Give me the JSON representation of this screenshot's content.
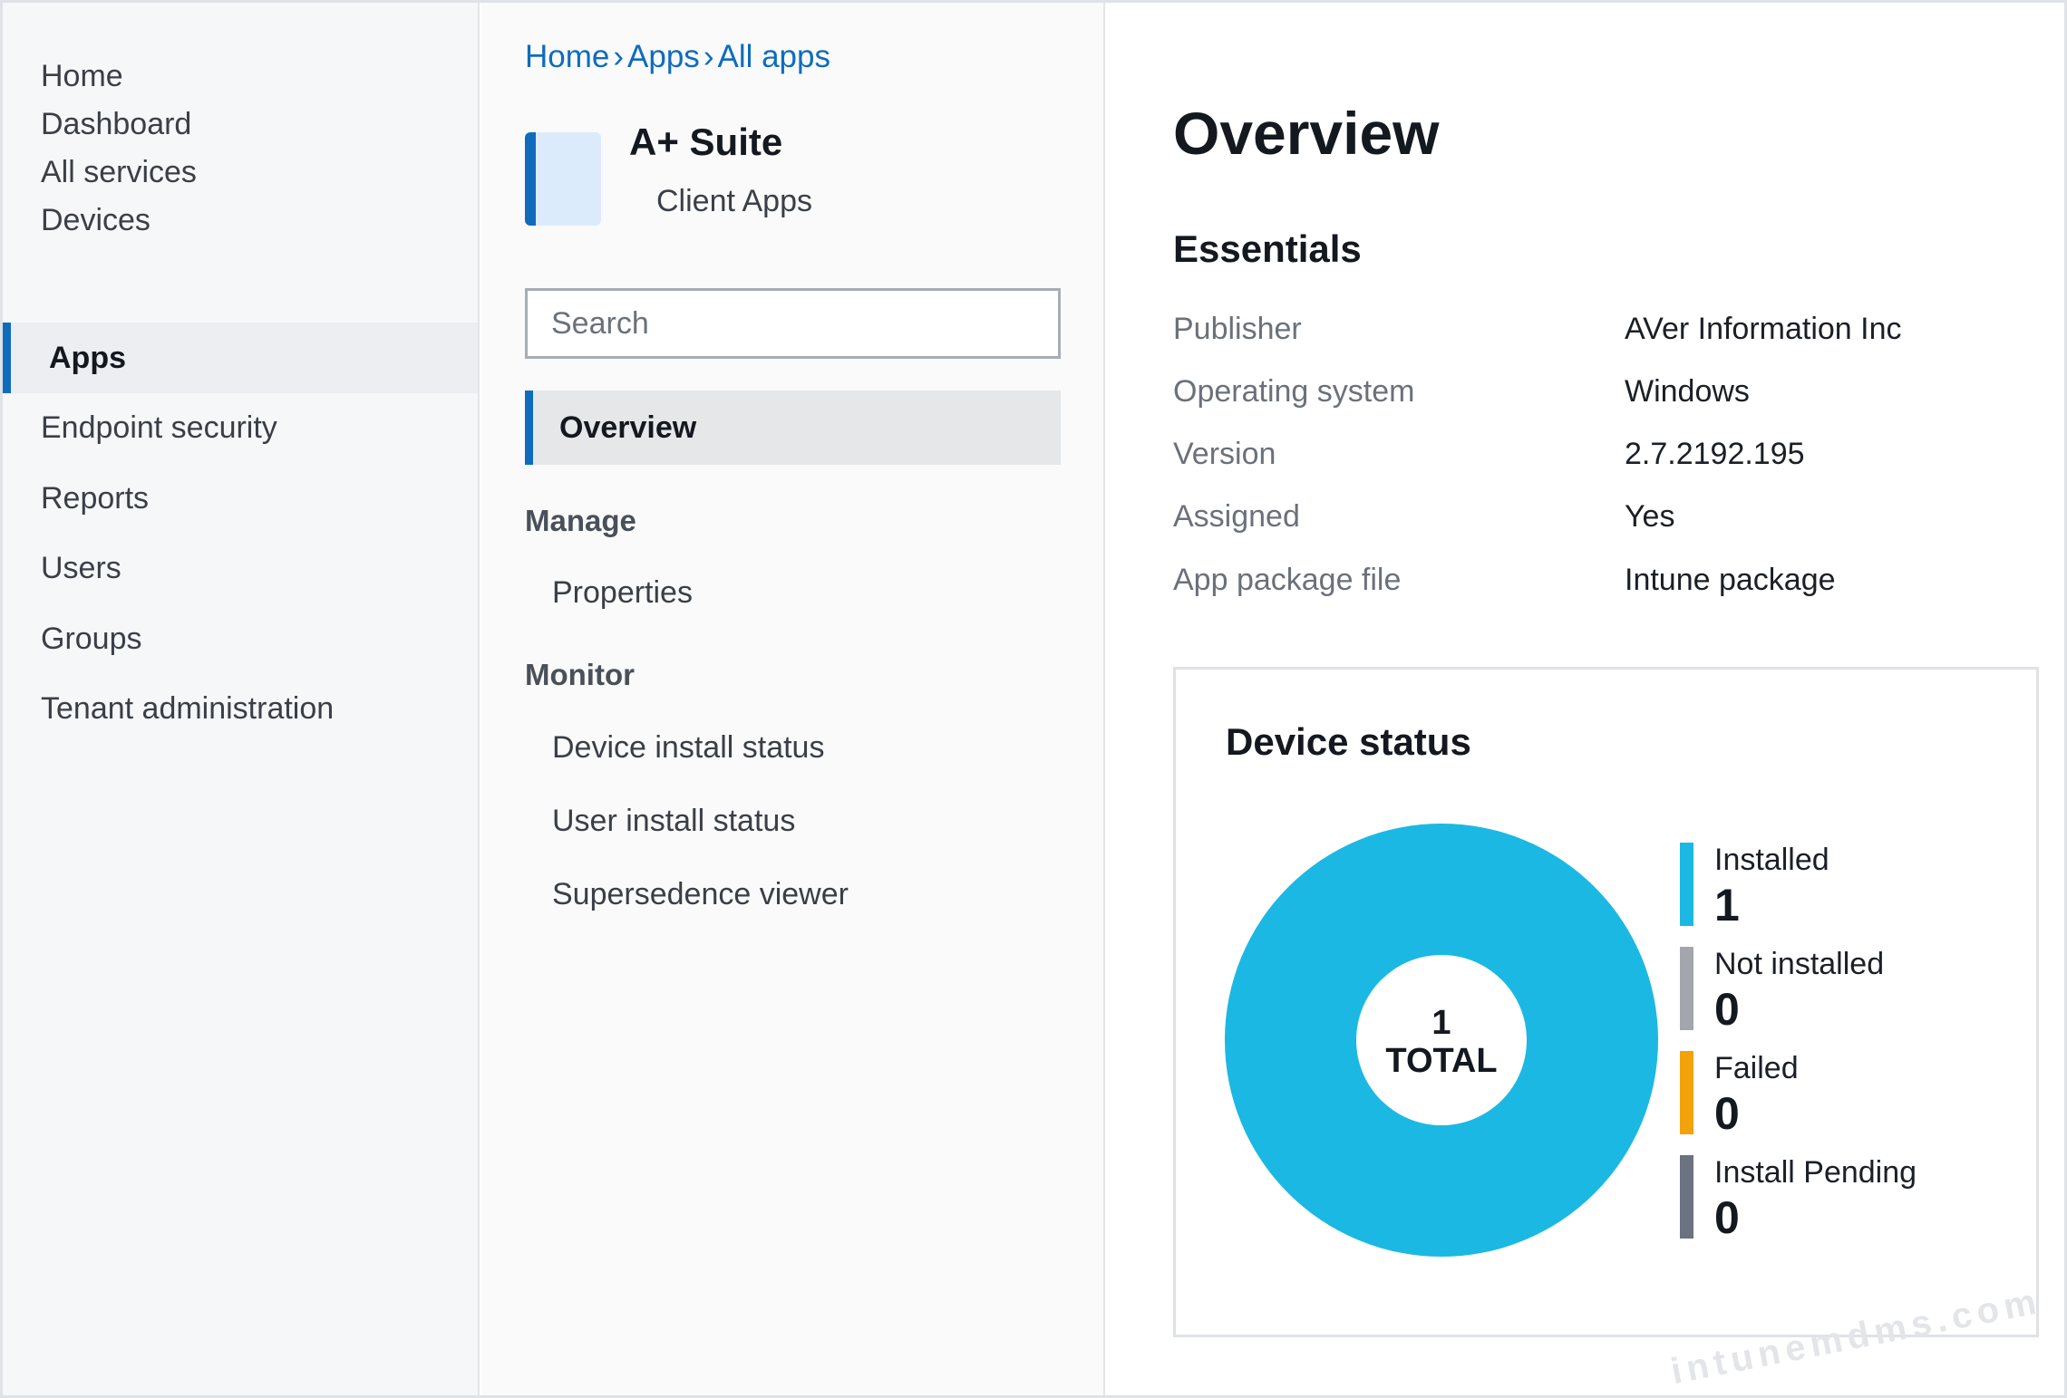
{
  "leftnav": {
    "items": [
      {
        "label": "Home"
      },
      {
        "label": "Dashboard"
      },
      {
        "label": "All services"
      },
      {
        "label": "Devices"
      },
      {
        "label": "Apps",
        "active": true
      },
      {
        "label": "Endpoint security"
      },
      {
        "label": "Reports"
      },
      {
        "label": "Users"
      },
      {
        "label": "Groups"
      },
      {
        "label": "Tenant administration"
      }
    ]
  },
  "blade": {
    "breadcrumb": [
      "Home",
      "Apps",
      "All apps"
    ],
    "breadcrumb_separator": "›",
    "app_name": "A+ Suite",
    "app_subtitle": "Client Apps",
    "search_placeholder": "Search",
    "active_item": "Overview",
    "sections": [
      {
        "heading": "Manage",
        "items": [
          "Properties"
        ]
      },
      {
        "heading": "Monitor",
        "items": [
          "Device install status",
          "User install status",
          "Supersedence viewer"
        ]
      }
    ]
  },
  "content": {
    "title": "Overview",
    "essentials_title": "Essentials",
    "essentials": [
      {
        "label": "Publisher",
        "value": "AVer Information Inc"
      },
      {
        "label": "Operating system",
        "value": "Windows"
      },
      {
        "label": "Version",
        "value": "2.7.2192.195"
      },
      {
        "label": "Assigned",
        "value": "Yes"
      },
      {
        "label": "App package file",
        "value": "Intune package"
      }
    ]
  },
  "device_status": {
    "title": "Device status",
    "total_value": "1",
    "total_label": "TOTAL",
    "legend": [
      {
        "label": "Installed",
        "count": "1",
        "color": "#1bb8e3"
      },
      {
        "label": "Not installed",
        "count": "0",
        "color": "#a3a6ad"
      },
      {
        "label": "Failed",
        "count": "0",
        "color": "#f2a20b"
      },
      {
        "label": "Install Pending",
        "count": "0",
        "color": "#6b7280"
      }
    ]
  },
  "chart_data": {
    "type": "pie",
    "title": "Device status",
    "categories": [
      "Installed",
      "Not installed",
      "Failed",
      "Install Pending"
    ],
    "values": [
      1,
      0,
      0,
      0
    ],
    "colors": [
      "#1bb8e3",
      "#a3a6ad",
      "#f2a20b",
      "#6b7280"
    ],
    "legend": "right"
  },
  "watermark": "intunemdms.com"
}
